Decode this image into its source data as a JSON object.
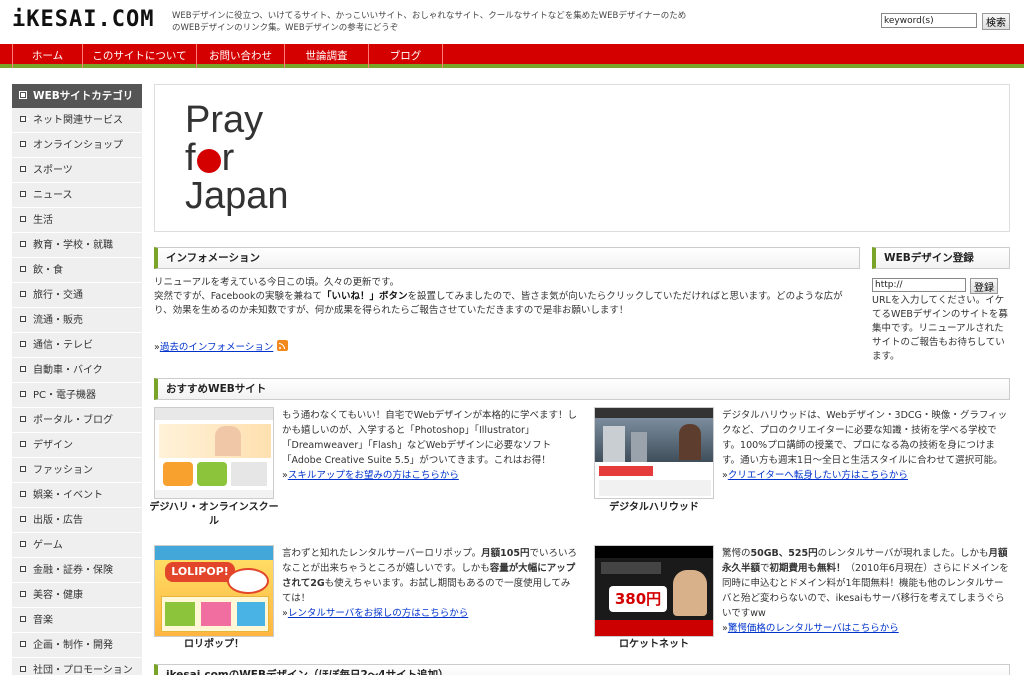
{
  "header": {
    "logo": "iKESAI.COM",
    "tagline": "WEBデザインに役立つ、いけてるサイト、かっこいいサイト、おしゃれなサイト、クールなサイトなどを集めたWEBデザイナーのためのWEBデザインのリンク集。WEBデザインの参考にどうぞ",
    "search_value": "keyword(s)",
    "search_button": "検索"
  },
  "nav": [
    {
      "label": "ホーム"
    },
    {
      "label": "このサイトについて"
    },
    {
      "label": "お問い合わせ"
    },
    {
      "label": "世論調査"
    },
    {
      "label": "ブログ"
    }
  ],
  "sidebar": {
    "header": "WEBサイトカテゴリー",
    "items": [
      "ネット関連サービス",
      "オンラインショップ",
      "スポーツ",
      "ニュース",
      "生活",
      "教育・学校・就職",
      "飲・食",
      "旅行・交通",
      "流通・販売",
      "通信・テレビ",
      "自動車・バイク",
      "PC・電子機器",
      "ポータル・ブログ",
      "デザイン",
      "ファッション",
      "娯楽・イベント",
      "出版・広告",
      "ゲーム",
      "金融・証券・保険",
      "美容・健康",
      "音楽",
      "企画・制作・開発",
      "社団・プロモーション"
    ]
  },
  "banner": {
    "line1": "Pray",
    "line2_pre": "f",
    "line2_post": "r",
    "line3": "Japan"
  },
  "info": {
    "title": "インフォメーション",
    "line1": "リニューアルを考えている今日この頃。久々の更新です。",
    "line2_a": "突然ですが、Facebookの実験を兼ねて",
    "line2_b": "「いいね！」ボタン",
    "line2_c": "を設置してみましたので、皆さま気が向いたらクリックしていただければと思います。どのような広がり、効果を生めるのか未知数ですが、何か成果を得られたらご報告させていただきますので是非お願いします！",
    "past_link": "過去のインフォメーション",
    "arrow": "»"
  },
  "register": {
    "title": "WEBデザイン登録",
    "input_value": "http://",
    "button": "登録",
    "text": "URLを入力してください。イケてるWEBデザインのサイトを募集中です。リニューアルされたサイトのご報告もお待ちしています。"
  },
  "recommend": {
    "title": "おすすめWEBサイト",
    "sites": [
      {
        "label": "デジハリ・オンラインスクール",
        "desc": "もう通わなくてもいい！自宅でWebデザインが本格的に学べます！しかも嬉しいのが、入学すると「Photoshop」「Illustrator」「Dreamweaver」「Flash」などWebデザインに必要なソフト「Adobe Creative Suite 5.5」がついてきます。これはお得！",
        "link": "スキルアップをお望みの方はこちらから"
      },
      {
        "label": "デジタルハリウッド",
        "desc": "デジタルハリウッドは、Webデザイン・3DCG・映像・グラフィックなど、プロのクリエイターに必要な知識・技術を学べる学校です。100%プロ講師の授業で、プロになる為の技術を身につけます。通い方も週末1日〜全日と生活スタイルに合わせて選択可能。",
        "link": "クリエイターへ転身したい方はこちらから"
      },
      {
        "label": "ロリポップ！",
        "desc_a": "言わずと知れたレンタルサーバーロリポップ。",
        "desc_b": "月額105円",
        "desc_c": "でいろいろなことが出来ちゃうところが嬉しいです。しかも",
        "desc_d": "容量が大幅にアップされて2G",
        "desc_e": "も使えちゃいます。お試し期間もあるので一度使用してみては！",
        "link": "レンタルサーバをお探しの方はこちらから",
        "banner_text": "LOLIPOP!"
      },
      {
        "label": "ロケットネット",
        "desc_a": "驚愕の",
        "desc_b": "50GB、525円",
        "desc_c": "のレンタルサーバが現れました。しかも",
        "desc_d": "月額永久半額",
        "desc_e": "で",
        "desc_f": "初期費用も無料！",
        "desc_g": "（2010年6月現在）さらにドメインを同時に申込むとドメイン料が1年間無料！機能も他のレンタルサーバと殆ど変わらないので、ikesaiもサーバ移行を考えてしまうぐらいですww",
        "link": "驚愕価格のレンタルサーバはこちらから",
        "banner_text": "380円"
      }
    ]
  },
  "bottom_section": {
    "title": "ikesai.comのWEBデザイン（ほぼ毎日2〜4サイト追加）"
  },
  "colors": {
    "nav_red": "#d40000",
    "accent_green": "#7aa427",
    "link_blue": "#0033cc"
  }
}
